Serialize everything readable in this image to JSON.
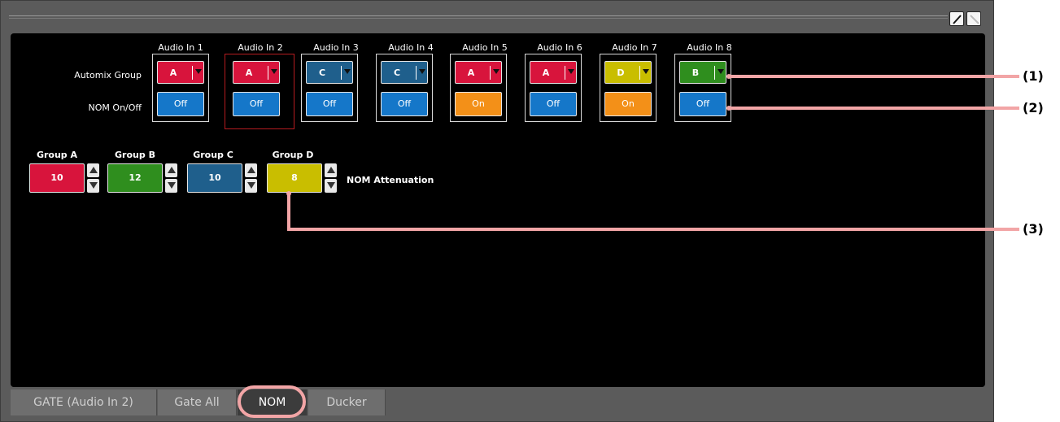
{
  "channels": [
    {
      "header": "Audio In 1",
      "group": "A",
      "nom": "Off"
    },
    {
      "header": "Audio In 2",
      "group": "A",
      "nom": "Off"
    },
    {
      "header": "Audio In 3",
      "group": "C",
      "nom": "Off"
    },
    {
      "header": "Audio In 4",
      "group": "C",
      "nom": "Off"
    },
    {
      "header": "Audio In 5",
      "group": "A",
      "nom": "On"
    },
    {
      "header": "Audio In 6",
      "group": "A",
      "nom": "Off"
    },
    {
      "header": "Audio In 7",
      "group": "D",
      "nom": "On"
    },
    {
      "header": "Audio In 8",
      "group": "B",
      "nom": "Off"
    }
  ],
  "row_labels": {
    "automix_group": "Automix Group",
    "nom_onoff": "NOM On/Off"
  },
  "groups": [
    {
      "name": "Group A",
      "value": "10"
    },
    {
      "name": "Group B",
      "value": "12"
    },
    {
      "name": "Group C",
      "value": "10"
    },
    {
      "name": "Group D",
      "value": "8"
    }
  ],
  "nom_attenuation_label": "NOM Attenuation",
  "tabs": [
    {
      "label": "GATE (Audio In 2)"
    },
    {
      "label": "Gate All"
    },
    {
      "label": "NOM"
    },
    {
      "label": "Ducker"
    }
  ],
  "callouts": [
    "(1)",
    "(2)",
    "(3)"
  ],
  "colors": {
    "group_A": "#d8143c",
    "group_B": "#2f8e1e",
    "group_C": "#1f5f8c",
    "group_D": "#c9be00",
    "off_button": "#1577c9",
    "on_button": "#f39018",
    "callout_line": "#f2a5a6",
    "selected_border": "#b51c20"
  }
}
